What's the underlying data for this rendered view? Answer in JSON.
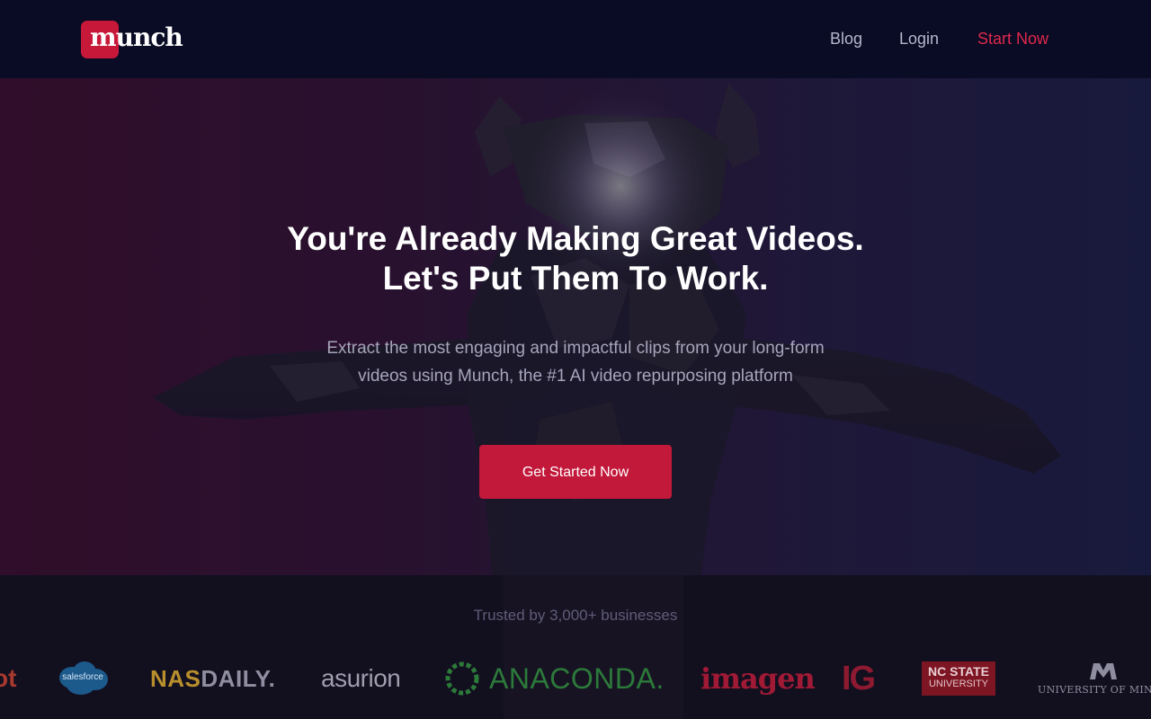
{
  "nav": {
    "logo_text": "munch",
    "links": [
      {
        "label": "Blog"
      },
      {
        "label": "Login"
      },
      {
        "label": "Start Now"
      }
    ]
  },
  "hero": {
    "headline_line1": "You're Already Making Great Videos.",
    "headline_line2": "Let's Put Them To Work.",
    "subhead_line1": "Extract the most engaging and impactful clips from your long-form",
    "subhead_line2": "videos using Munch, the #1 AI video repurposing platform",
    "cta_label": "Get Started Now"
  },
  "trusted": {
    "title": "Trusted by 3,000+ businesses",
    "logos": {
      "hubspot": "ot",
      "salesforce": "salesforce",
      "nasdaily_a": "NAS",
      "nasdaily_b": "DAILY.",
      "asurion": "asurion",
      "anaconda": "ANACONDA.",
      "imagen": "imagen",
      "ig": "IG",
      "ncstate_a": "NC STATE",
      "ncstate_b": "UNIVERSITY",
      "umn": "UNIVERSITY OF MINNESOTA"
    }
  },
  "colors": {
    "accent": "#c2183a",
    "nav_bg": "#0a0b24",
    "start_now": "#e0294c"
  }
}
